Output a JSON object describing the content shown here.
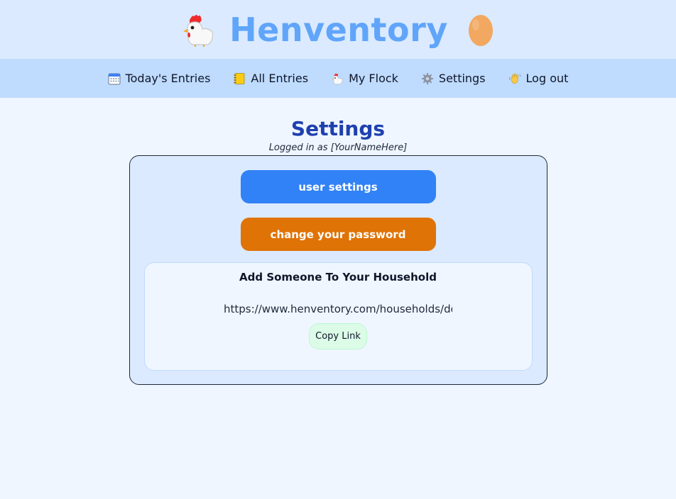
{
  "app": {
    "title": "Henventory",
    "icons": {
      "left": "chicken-emoji",
      "right": "egg-emoji"
    }
  },
  "nav": {
    "items": [
      {
        "label": "Today's Entries",
        "icon": "calendar-icon"
      },
      {
        "label": "All Entries",
        "icon": "notebook-icon"
      },
      {
        "label": "My Flock",
        "icon": "chicken-icon"
      },
      {
        "label": "Settings",
        "icon": "gear-icon"
      },
      {
        "label": "Log out",
        "icon": "waving-hand-icon"
      }
    ]
  },
  "page": {
    "title": "Settings",
    "subtitle": "Logged in as [YourNameHere]"
  },
  "settings": {
    "user_settings_label": "user settings",
    "change_password_label": "change your password"
  },
  "household": {
    "title": "Add Someone To Your Household",
    "link_value": "https://www.henventory.com/households/dqhl",
    "copy_label": "Copy Link"
  },
  "colors": {
    "header_bg": "#dbeafe",
    "nav_bg": "#bfdbfe",
    "title_blue": "#60a5fa",
    "heading_blue": "#1e40af",
    "primary_button": "#3182f6",
    "warning_button": "#df7306",
    "copy_button": "#dcfce7",
    "page_bg": "#eff6ff"
  }
}
